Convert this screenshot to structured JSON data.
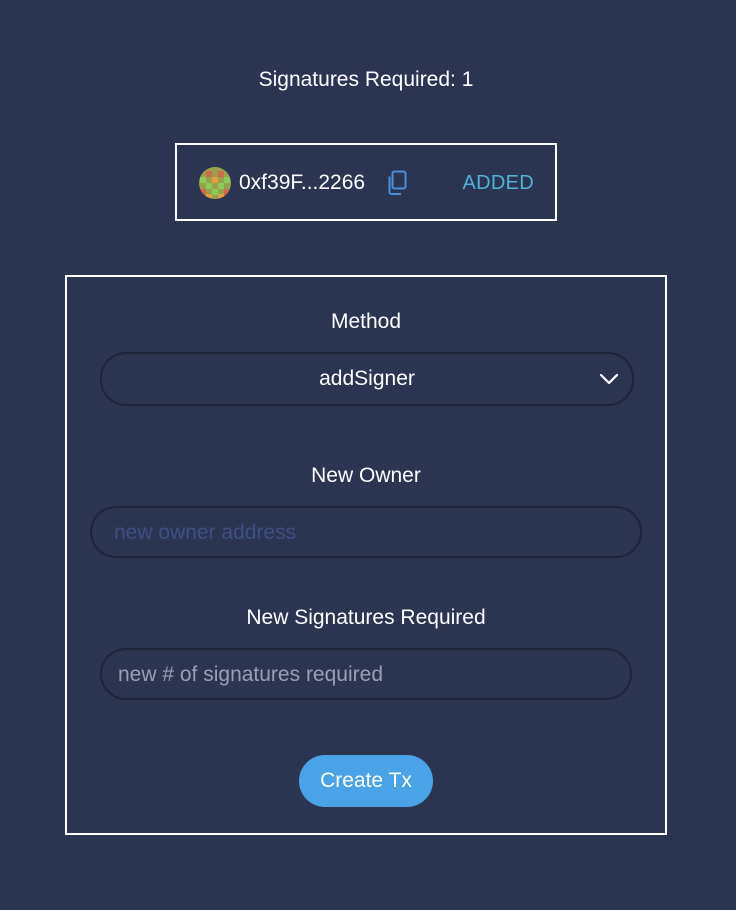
{
  "signatures_required": "Signatures Required: 1",
  "owner": {
    "address": "0xf39F...2266",
    "status": "ADDED",
    "copy_icon": "copy-icon",
    "avatar_icon": "blockie-avatar",
    "status_color": "#4fb3d9"
  },
  "form": {
    "method_label": "Method",
    "method_value": "addSigner",
    "new_owner_label": "New Owner",
    "new_owner_placeholder": "new owner address",
    "new_signatures_label": "New Signatures Required",
    "new_signatures_placeholder": "new # of signatures required",
    "submit_label": "Create Tx"
  },
  "colors": {
    "background": "#2b3451",
    "accent_button": "#4aa3e6",
    "placeholder_dim": "#3f4f85",
    "placeholder_light": "#9aa0b4"
  }
}
